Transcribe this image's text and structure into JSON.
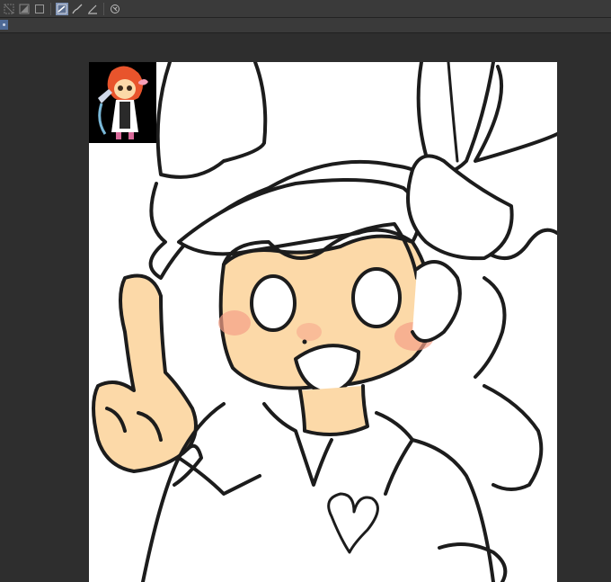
{
  "toolbar": {
    "tools": [
      {
        "icon": "select-icon"
      },
      {
        "icon": "shape-select-icon"
      },
      {
        "icon": "rect-icon"
      },
      {
        "icon": "pen-tool-icon",
        "active": true
      },
      {
        "icon": "brush-icon"
      },
      {
        "icon": "ruler-pen-icon"
      },
      {
        "icon": "special-ruler-icon"
      }
    ]
  },
  "colors": {
    "skin": "#fcd9a8",
    "blush": "#f5a088",
    "line": "#1c1c1c",
    "hair": "#ffffff",
    "thumb_hair": "#e8542c"
  }
}
